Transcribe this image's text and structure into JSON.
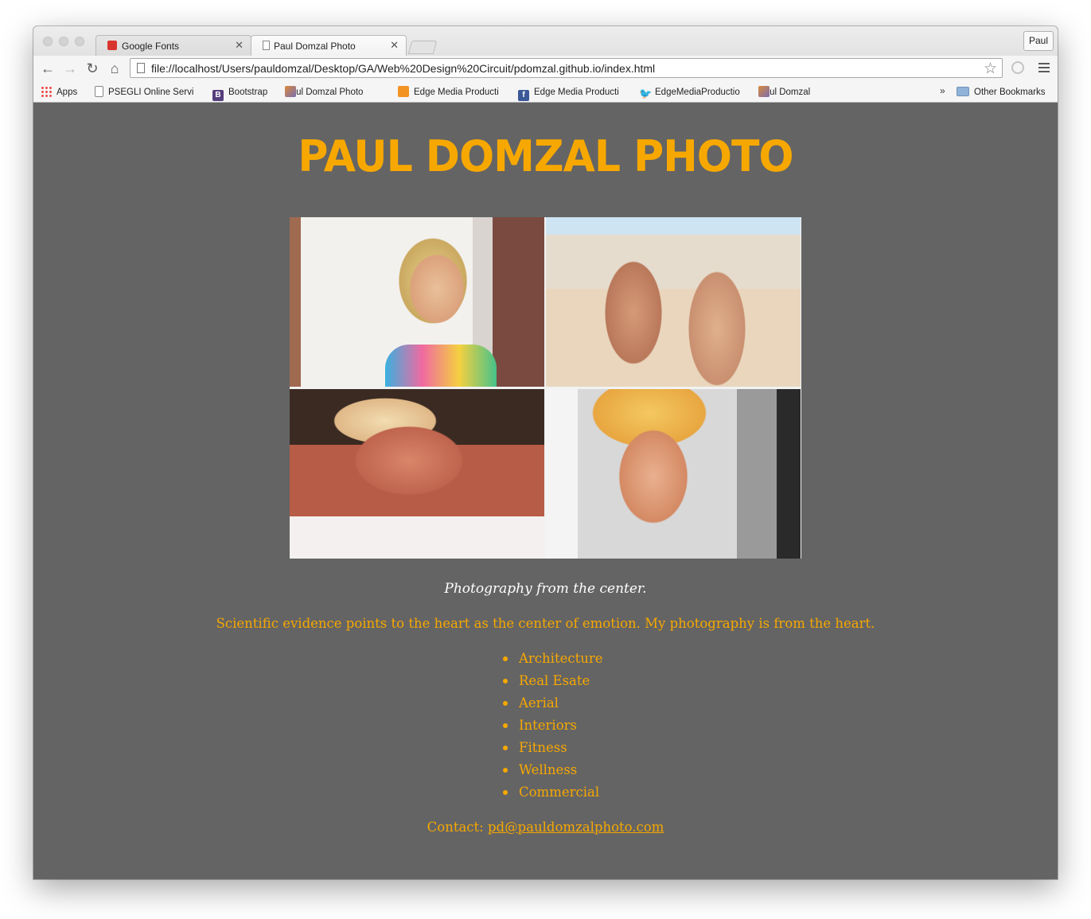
{
  "browser": {
    "tabs": [
      {
        "title": "Google Fonts",
        "favicon": "google-fonts-icon",
        "active": false
      },
      {
        "title": "Paul Domzal Photo",
        "favicon": "page-icon",
        "active": true
      }
    ],
    "profile_name": "Paul",
    "url": "file://localhost/Users/pauldomzal/Desktop/GA/Web%20Design%20Circuit/pdomzal.github.io/index.html",
    "bookmarks": [
      {
        "label": "Apps",
        "icon": "apps-grid-icon"
      },
      {
        "label": "PSEGLI Online Servi",
        "icon": "page-icon"
      },
      {
        "label": "Bootstrap",
        "icon": "bootstrap-icon"
      },
      {
        "label": "Paul Domzal Photo",
        "icon": "photo-favicon"
      },
      {
        "label": "Edge Media Producti",
        "icon": "edge-media-icon"
      },
      {
        "label": "Edge Media Producti",
        "icon": "facebook-icon"
      },
      {
        "label": "EdgeMediaProductio",
        "icon": "twitter-icon"
      },
      {
        "label": "Paul Domzal",
        "icon": "photo-favicon"
      }
    ],
    "overflow_label": "»",
    "other_bookmarks": "Other Bookmarks"
  },
  "page": {
    "site_title": "PAUL DOMZAL PHOTO",
    "tagline": "Photography from the center.",
    "lead": "Scientific evidence points to the heart as the center of emotion. My photography is from the heart.",
    "services": [
      "Architecture",
      "Real Esate",
      "Aerial",
      "Interiors",
      "Fitness",
      "Wellness",
      "Commercial"
    ],
    "contact_label": "Contact:",
    "contact_email": "pd@pauldomzalphoto.com"
  },
  "colors": {
    "accent": "#f7a800",
    "page_background": "#646464",
    "tagline": "#ffffff"
  }
}
